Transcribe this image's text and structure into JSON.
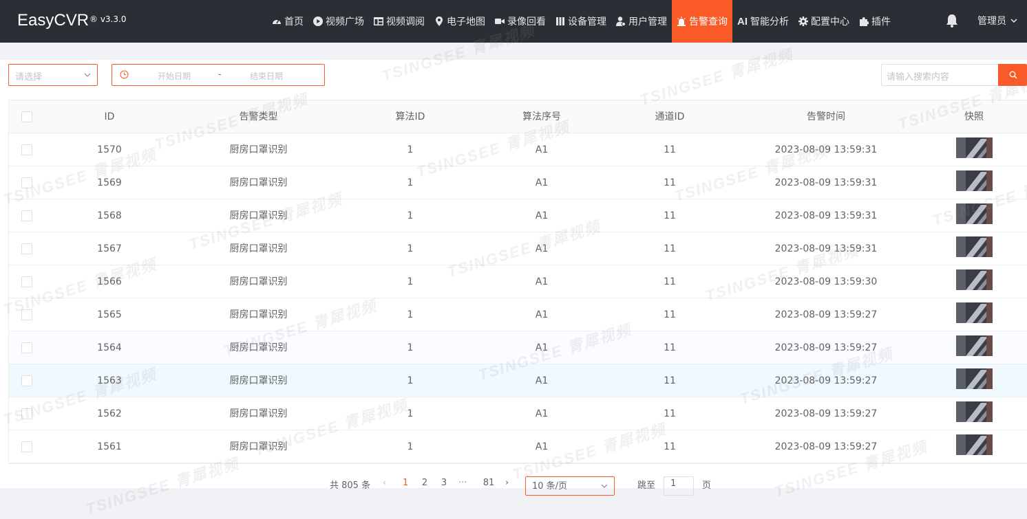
{
  "app": {
    "name": "EasyCVR",
    "version": "® v3.3.0"
  },
  "nav": {
    "items": [
      {
        "label": "首页",
        "icon": "dashboard-icon"
      },
      {
        "label": "视频广场",
        "icon": "play-circle-icon"
      },
      {
        "label": "视频调阅",
        "icon": "grid-layout-icon"
      },
      {
        "label": "电子地图",
        "icon": "map-pin-icon"
      },
      {
        "label": "录像回看",
        "icon": "video-camera-icon"
      },
      {
        "label": "设备管理",
        "icon": "device-icon"
      },
      {
        "label": "用户管理",
        "icon": "user-gear-icon"
      },
      {
        "label": "告警查询",
        "icon": "alarm-light-icon",
        "active": true
      },
      {
        "label": "智能分析",
        "icon": "ai-text-icon",
        "prefix": "AI"
      },
      {
        "label": "配置中心",
        "icon": "gear-icon"
      },
      {
        "label": "插件",
        "icon": "puzzle-icon"
      }
    ],
    "user": "管理员"
  },
  "filters": {
    "select_placeholder": "请选择",
    "date_start_placeholder": "开始日期",
    "date_separator": "-",
    "date_end_placeholder": "结束日期",
    "search_placeholder": "请输入搜索内容"
  },
  "table": {
    "headers": {
      "id": "ID",
      "type": "告警类型",
      "alg_id": "算法ID",
      "alg_seq": "算法序号",
      "channel": "通道ID",
      "time": "告警时间",
      "snapshot": "快照"
    },
    "rows": [
      {
        "id": "1570",
        "type": "厨房口罩识别",
        "alg_id": "1",
        "alg_seq": "A1",
        "channel": "11",
        "time": "2023-08-09 13:59:31"
      },
      {
        "id": "1569",
        "type": "厨房口罩识别",
        "alg_id": "1",
        "alg_seq": "A1",
        "channel": "11",
        "time": "2023-08-09 13:59:31"
      },
      {
        "id": "1568",
        "type": "厨房口罩识别",
        "alg_id": "1",
        "alg_seq": "A1",
        "channel": "11",
        "time": "2023-08-09 13:59:31"
      },
      {
        "id": "1567",
        "type": "厨房口罩识别",
        "alg_id": "1",
        "alg_seq": "A1",
        "channel": "11",
        "time": "2023-08-09 13:59:31"
      },
      {
        "id": "1566",
        "type": "厨房口罩识别",
        "alg_id": "1",
        "alg_seq": "A1",
        "channel": "11",
        "time": "2023-08-09 13:59:30"
      },
      {
        "id": "1565",
        "type": "厨房口罩识别",
        "alg_id": "1",
        "alg_seq": "A1",
        "channel": "11",
        "time": "2023-08-09 13:59:27"
      },
      {
        "id": "1564",
        "type": "厨房口罩识别",
        "alg_id": "1",
        "alg_seq": "A1",
        "channel": "11",
        "time": "2023-08-09 13:59:27"
      },
      {
        "id": "1563",
        "type": "厨房口罩识别",
        "alg_id": "1",
        "alg_seq": "A1",
        "channel": "11",
        "time": "2023-08-09 13:59:27"
      },
      {
        "id": "1562",
        "type": "厨房口罩识别",
        "alg_id": "1",
        "alg_seq": "A1",
        "channel": "11",
        "time": "2023-08-09 13:59:27"
      },
      {
        "id": "1561",
        "type": "厨房口罩识别",
        "alg_id": "1",
        "alg_seq": "A1",
        "channel": "11",
        "time": "2023-08-09 13:59:27"
      }
    ]
  },
  "pagination": {
    "total": "共 805 条",
    "pages": [
      "1",
      "2",
      "3",
      "···",
      "81"
    ],
    "current": "1",
    "page_size": "10 条/页",
    "goto_label": "跳至",
    "goto_value": "1",
    "goto_unit": "页"
  },
  "watermark": "TSINGSEE 青犀视频",
  "colors": {
    "accent": "#fa5a28",
    "topbar": "#2b2f35"
  }
}
